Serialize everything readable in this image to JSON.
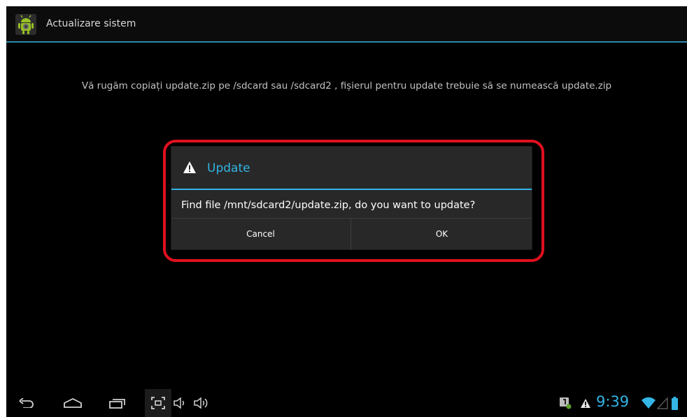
{
  "app": {
    "title": "Actualizare sistem",
    "icon": "android-settings-icon"
  },
  "main": {
    "message": "Vă rugăm copiați update.zip pe /sdcard sau /sdcard2 , fișierul pentru update trebuie să se numească update.zip"
  },
  "dialog": {
    "title": "Update",
    "icon": "warning-icon",
    "message": "Find file /mnt/sdcard2/update.zip, do you want to update?",
    "cancel_label": "Cancel",
    "ok_label": "OK"
  },
  "navbar": {
    "buttons": [
      "back-icon",
      "home-icon",
      "recent-apps-icon",
      "screenshot-icon",
      "volume-down-icon",
      "volume-up-icon"
    ]
  },
  "status": {
    "time": "9:39",
    "icons": [
      "notification-app-icon",
      "warning-icon",
      "wifi-icon",
      "cell-signal-icon",
      "battery-icon"
    ]
  },
  "colors": {
    "accent": "#33b5e5",
    "highlight": "#e0101e",
    "background": "#000000"
  }
}
